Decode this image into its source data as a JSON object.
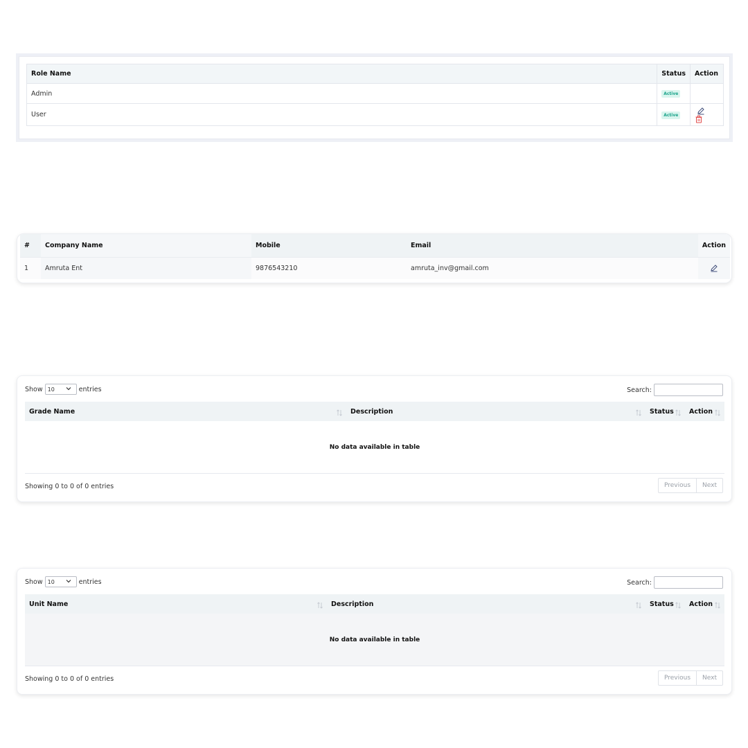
{
  "roles": {
    "headers": [
      "Role Name",
      "Status",
      "Action"
    ],
    "rows": [
      {
        "name": "Admin",
        "status": "Active"
      },
      {
        "name": "User",
        "status": "Active"
      }
    ]
  },
  "companies": {
    "headers": [
      "#",
      "Company Name",
      "Mobile",
      "Email",
      "Action"
    ],
    "rows": [
      {
        "index": "1",
        "name": "Amruta Ent",
        "mobile": "9876543210",
        "email": "amruta_inv@gmail.com"
      }
    ]
  },
  "grades": {
    "show_label": "Show",
    "entries_label": "entries",
    "page_size": "10",
    "search_label": "Search:",
    "headers": [
      "Grade Name",
      "Description",
      "Status",
      "Action"
    ],
    "empty_message": "No data available in table",
    "info": "Showing 0 to 0 of 0 entries",
    "prev": "Previous",
    "next": "Next"
  },
  "units": {
    "show_label": "Show",
    "entries_label": "entries",
    "page_size": "10",
    "search_label": "Search:",
    "headers": [
      "Unit Name",
      "Description",
      "Status",
      "Action"
    ],
    "empty_message": "No data available in table",
    "info": "Showing 0 to 0 of 0 entries",
    "prev": "Previous",
    "next": "Next"
  },
  "colors": {
    "badge_bg": "#d9f5ee",
    "badge_text": "#1aa38a",
    "edit_icon": "#3f4d7a",
    "delete_icon": "#e04b4b",
    "header_bg": "#eff3f5"
  },
  "icons": {
    "edit": "pencil-edit-icon",
    "delete": "trash-icon",
    "sort": "sort-arrows-icon",
    "dropdown": "chevron-down-icon"
  }
}
